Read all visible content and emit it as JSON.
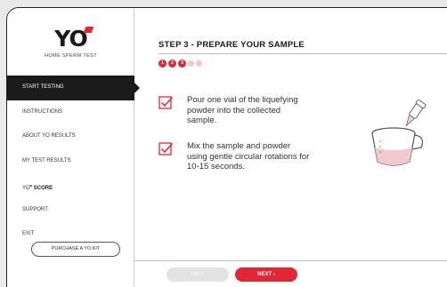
{
  "brand": {
    "logo_text": "YO",
    "subtitle": "HOME SPERM TEST"
  },
  "sidebar": {
    "items": [
      {
        "label": "START TESTING",
        "active": true
      },
      {
        "label": "INSTRUCTIONS"
      },
      {
        "label": "ABOUT YO RESULTS"
      },
      {
        "label": "MY TEST RESULTS"
      },
      {
        "prefix": "YO",
        "label": "SCORE"
      },
      {
        "label": "SUPPORT"
      },
      {
        "label": "EXIT"
      }
    ],
    "purchase_label": "PURCHASE A YO KIT"
  },
  "main": {
    "step_title": "STEP 3 - PREPARE YOUR SAMPLE",
    "progress": {
      "steps": [
        "1",
        "2",
        "3",
        "4",
        "5"
      ],
      "current": 3
    },
    "instructions": [
      "Pour one vial of the liquefying powder into the collected sample.",
      "Mix the sample and powder using gentle circular rotations for 10-15 seconds."
    ]
  },
  "footer": {
    "back_label": "BACK",
    "next_label": "NEXT  ›"
  },
  "colors": {
    "accent": "#e32636",
    "accent_light": "#f6c7cb",
    "sidebar_active": "#1b1b1b"
  }
}
